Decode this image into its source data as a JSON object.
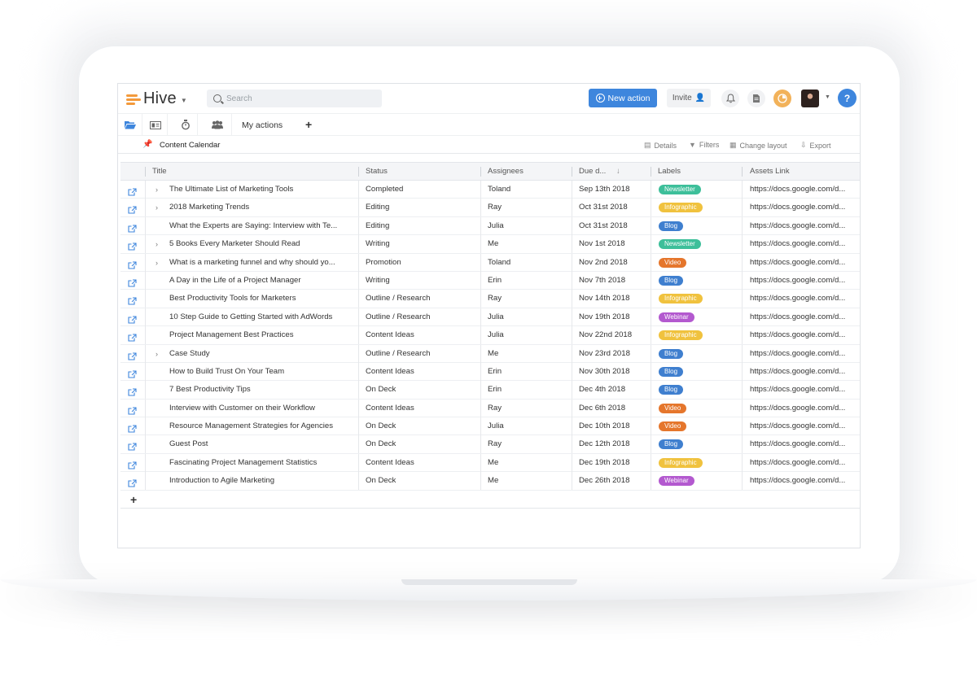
{
  "app": {
    "logo_text": "Hive",
    "search_placeholder": "Search",
    "new_action_label": "New action",
    "invite_label": "Invite",
    "help_label": "?"
  },
  "nav": {
    "tab_label": "My actions",
    "icons": [
      "folder-icon",
      "card-icon",
      "timer-icon",
      "team-icon"
    ]
  },
  "project": {
    "title": "Content Calendar",
    "actions": {
      "details": "Details",
      "filters": "Filters",
      "change_layout": "Change layout",
      "export": "Export"
    }
  },
  "table": {
    "columns": {
      "title": "Title",
      "status": "Status",
      "assignees": "Assignees",
      "due": "Due d...",
      "labels": "Labels",
      "assets": "Assets Link"
    },
    "rows": [
      {
        "title": "The Ultimate List of Marketing Tools",
        "expand": true,
        "status": "Completed",
        "assignee": "Toland",
        "due": "Sep 13th 2018",
        "label": "Newsletter",
        "link": "https://docs.google.com/d..."
      },
      {
        "title": "2018 Marketing Trends",
        "expand": true,
        "status": "Editing",
        "assignee": "Ray",
        "due": "Oct 31st 2018",
        "label": "Infographic",
        "link": "https://docs.google.com/d..."
      },
      {
        "title": "What the Experts are Saying: Interview with Te...",
        "expand": false,
        "status": "Editing",
        "assignee": "Julia",
        "due": "Oct 31st 2018",
        "label": "Blog",
        "link": "https://docs.google.com/d..."
      },
      {
        "title": "5 Books Every Marketer Should Read",
        "expand": true,
        "status": "Writing",
        "assignee": "Me",
        "due": "Nov 1st 2018",
        "label": "Newsletter",
        "link": "https://docs.google.com/d..."
      },
      {
        "title": "What is a marketing funnel and why should yo...",
        "expand": true,
        "status": "Promotion",
        "assignee": "Toland",
        "due": "Nov 2nd 2018",
        "label": "Video",
        "link": "https://docs.google.com/d..."
      },
      {
        "title": "A Day in the Life of a Project Manager",
        "expand": false,
        "status": "Writing",
        "assignee": "Erin",
        "due": "Nov 7th 2018",
        "label": "Blog",
        "link": "https://docs.google.com/d..."
      },
      {
        "title": "Best Productivity Tools for Marketers",
        "expand": false,
        "status": "Outline / Research",
        "assignee": "Ray",
        "due": "Nov 14th 2018",
        "label": "Infographic",
        "link": "https://docs.google.com/d..."
      },
      {
        "title": "10 Step Guide to Getting Started with AdWords",
        "expand": false,
        "status": "Outline / Research",
        "assignee": "Julia",
        "due": "Nov 19th 2018",
        "label": "Webinar",
        "link": "https://docs.google.com/d..."
      },
      {
        "title": "Project Management Best Practices",
        "expand": false,
        "status": "Content Ideas",
        "assignee": "Julia",
        "due": "Nov 22nd 2018",
        "label": "Infographic",
        "link": "https://docs.google.com/d..."
      },
      {
        "title": "Case Study",
        "expand": true,
        "status": "Outline / Research",
        "assignee": "Me",
        "due": "Nov 23rd 2018",
        "label": "Blog",
        "link": "https://docs.google.com/d..."
      },
      {
        "title": "How to Build Trust On Your Team",
        "expand": false,
        "status": "Content Ideas",
        "assignee": "Erin",
        "due": "Nov 30th 2018",
        "label": "Blog",
        "link": "https://docs.google.com/d..."
      },
      {
        "title": "7 Best Productivity Tips",
        "expand": false,
        "status": "On Deck",
        "assignee": "Erin",
        "due": "Dec 4th 2018",
        "label": "Blog",
        "link": "https://docs.google.com/d..."
      },
      {
        "title": "Interview with Customer on their Workflow",
        "expand": false,
        "status": "Content Ideas",
        "assignee": "Ray",
        "due": "Dec 6th 2018",
        "label": "Video",
        "link": "https://docs.google.com/d..."
      },
      {
        "title": "Resource Management Strategies for Agencies",
        "expand": false,
        "status": "On Deck",
        "assignee": "Julia",
        "due": "Dec 10th 2018",
        "label": "Video",
        "link": "https://docs.google.com/d..."
      },
      {
        "title": "Guest Post",
        "expand": false,
        "status": "On Deck",
        "assignee": "Ray",
        "due": "Dec 12th 2018",
        "label": "Blog",
        "link": "https://docs.google.com/d..."
      },
      {
        "title": "Fascinating Project Management Statistics",
        "expand": false,
        "status": "Content Ideas",
        "assignee": "Me",
        "due": "Dec 19th 2018",
        "label": "Infographic",
        "link": "https://docs.google.com/d..."
      },
      {
        "title": "Introduction to Agile Marketing",
        "expand": false,
        "status": "On Deck",
        "assignee": "Me",
        "due": "Dec 26th 2018",
        "label": "Webinar",
        "link": "https://docs.google.com/d..."
      }
    ]
  },
  "label_colors": {
    "Newsletter": "#3dbf9a",
    "Infographic": "#f0c23e",
    "Blog": "#3f7fcf",
    "Video": "#e5762c",
    "Webinar": "#b359cf"
  },
  "colors": {
    "accent": "#3e86dd",
    "brand_orange": "#f39a3c"
  }
}
